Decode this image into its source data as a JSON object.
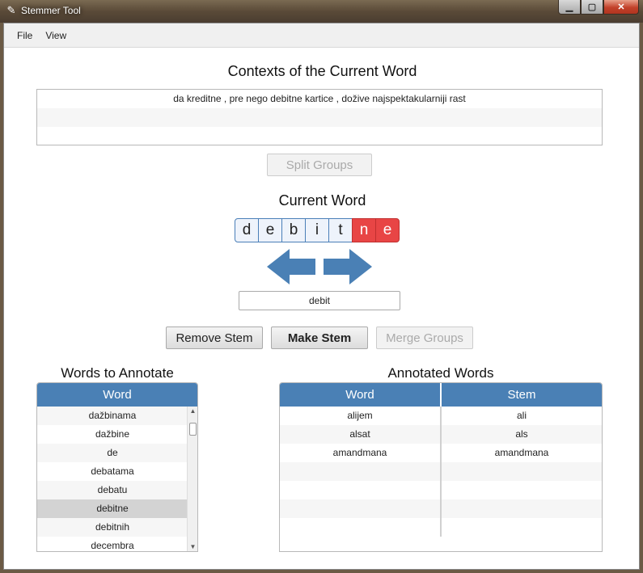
{
  "window": {
    "title": "Stemmer Tool",
    "app_icon": "pencil-icon"
  },
  "window_controls": {
    "minimize": "▁",
    "maximize": "▢",
    "close": "✕"
  },
  "menu": [
    "File",
    "View"
  ],
  "contexts": {
    "title": "Contexts of the Current Word",
    "rows": [
      "da kreditne , pre nego debitne kartice , dožive najspektakularniji rast",
      "",
      ""
    ]
  },
  "buttons": {
    "split_groups": "Split Groups",
    "remove_stem": "Remove Stem",
    "make_stem": "Make Stem",
    "merge_groups": "Merge Groups"
  },
  "current_word": {
    "title": "Current Word",
    "letters": [
      "d",
      "e",
      "b",
      "i",
      "t",
      "n",
      "e"
    ],
    "highlighted_from_index": 5,
    "stem_value": "debit",
    "highlight_color": "#e84545",
    "arrow_color": "#4a80b5"
  },
  "words_to_annotate": {
    "title": "Words to Annotate",
    "column": "Word",
    "rows": [
      "dažbinama",
      "dažbine",
      "de",
      "debatama",
      "debatu",
      "debitne",
      "debitnih",
      "decembra"
    ],
    "selected_index": 5
  },
  "annotated_words": {
    "title": "Annotated Words",
    "columns": [
      "Word",
      "Stem"
    ],
    "rows": [
      [
        "alijem",
        "ali"
      ],
      [
        "alsat",
        "als"
      ],
      [
        "amandmana",
        "amandmana"
      ],
      [
        "",
        ""
      ],
      [
        "",
        ""
      ],
      [
        "",
        ""
      ],
      [
        "",
        ""
      ]
    ]
  },
  "colors": {
    "header_blue": "#4a80b5"
  }
}
